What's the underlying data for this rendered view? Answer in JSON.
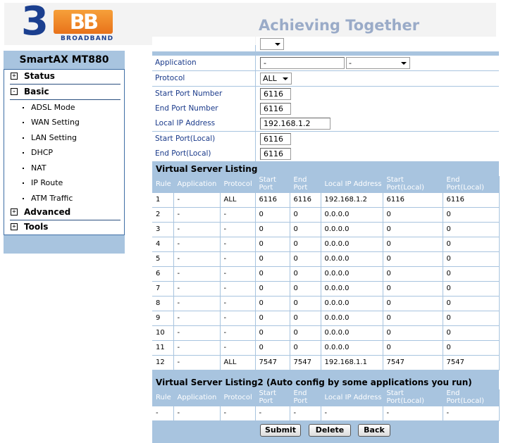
{
  "brand": {
    "logo_text": "3BB",
    "logo_sub": "BROADBAND",
    "slogan": "Achieving Together"
  },
  "sidebar": {
    "title": "SmartAX MT880",
    "groups": [
      {
        "label": "Status",
        "expanded": false,
        "toggle": "+"
      },
      {
        "label": "Basic",
        "expanded": true,
        "toggle": "-"
      },
      {
        "label": "Advanced",
        "expanded": false,
        "toggle": "+"
      },
      {
        "label": "Tools",
        "expanded": false,
        "toggle": "+"
      }
    ],
    "basic_items": [
      "ADSL Mode",
      "WAN Setting",
      "LAN Setting",
      "DHCP",
      "NAT",
      "IP Route",
      "ATM Traffic"
    ]
  },
  "form": {
    "application_label": "Application",
    "application_value": "-",
    "application_select": "-",
    "protocol_label": "Protocol",
    "protocol_value": "ALL",
    "start_port_label": "Start Port Number",
    "start_port_value": "6116",
    "end_port_label": "End Port Number",
    "end_port_value": "6116",
    "local_ip_label": "Local IP Address",
    "local_ip_value": "192.168.1.2",
    "start_port_local_label": "Start Port(Local)",
    "start_port_local_value": "6116",
    "end_port_local_label": "End Port(Local)",
    "end_port_local_value": "6116"
  },
  "listing": {
    "title": "Virtual Server Listing",
    "headers": [
      "Rule",
      "Application",
      "Protocol",
      "Start Port",
      "End Port",
      "Local IP Address",
      "Start Port(Local)",
      "End Port(Local)"
    ],
    "rows": [
      [
        "1",
        "-",
        "ALL",
        "6116",
        "6116",
        "192.168.1.2",
        "6116",
        "6116"
      ],
      [
        "2",
        "-",
        "-",
        "0",
        "0",
        "0.0.0.0",
        "0",
        "0"
      ],
      [
        "3",
        "-",
        "-",
        "0",
        "0",
        "0.0.0.0",
        "0",
        "0"
      ],
      [
        "4",
        "-",
        "-",
        "0",
        "0",
        "0.0.0.0",
        "0",
        "0"
      ],
      [
        "5",
        "-",
        "-",
        "0",
        "0",
        "0.0.0.0",
        "0",
        "0"
      ],
      [
        "6",
        "-",
        "-",
        "0",
        "0",
        "0.0.0.0",
        "0",
        "0"
      ],
      [
        "7",
        "-",
        "-",
        "0",
        "0",
        "0.0.0.0",
        "0",
        "0"
      ],
      [
        "8",
        "-",
        "-",
        "0",
        "0",
        "0.0.0.0",
        "0",
        "0"
      ],
      [
        "9",
        "-",
        "-",
        "0",
        "0",
        "0.0.0.0",
        "0",
        "0"
      ],
      [
        "10",
        "-",
        "-",
        "0",
        "0",
        "0.0.0.0",
        "0",
        "0"
      ],
      [
        "11",
        "-",
        "-",
        "0",
        "0",
        "0.0.0.0",
        "0",
        "0"
      ],
      [
        "12",
        "-",
        "ALL",
        "7547",
        "7547",
        "192.168.1.1",
        "7547",
        "7547"
      ]
    ]
  },
  "listing2": {
    "title": "Virtual Server Listing2 (Auto config by some applications you run)",
    "headers": [
      "Rule",
      "Application",
      "Protocol",
      "Start Port",
      "End Port",
      "Local IP Address",
      "Start Port(Local)",
      "End Port(Local)"
    ],
    "rows": [
      [
        "-",
        "-",
        "-",
        "-",
        "-",
        "-",
        "-",
        "-"
      ]
    ]
  },
  "buttons": {
    "submit": "Submit",
    "delete": "Delete",
    "back": "Back"
  },
  "colors": {
    "panel": "#a8c4df",
    "label_text": "#1a3a8a",
    "logo_blue": "#1b3f8f",
    "logo_orange": "#f08a2a"
  }
}
